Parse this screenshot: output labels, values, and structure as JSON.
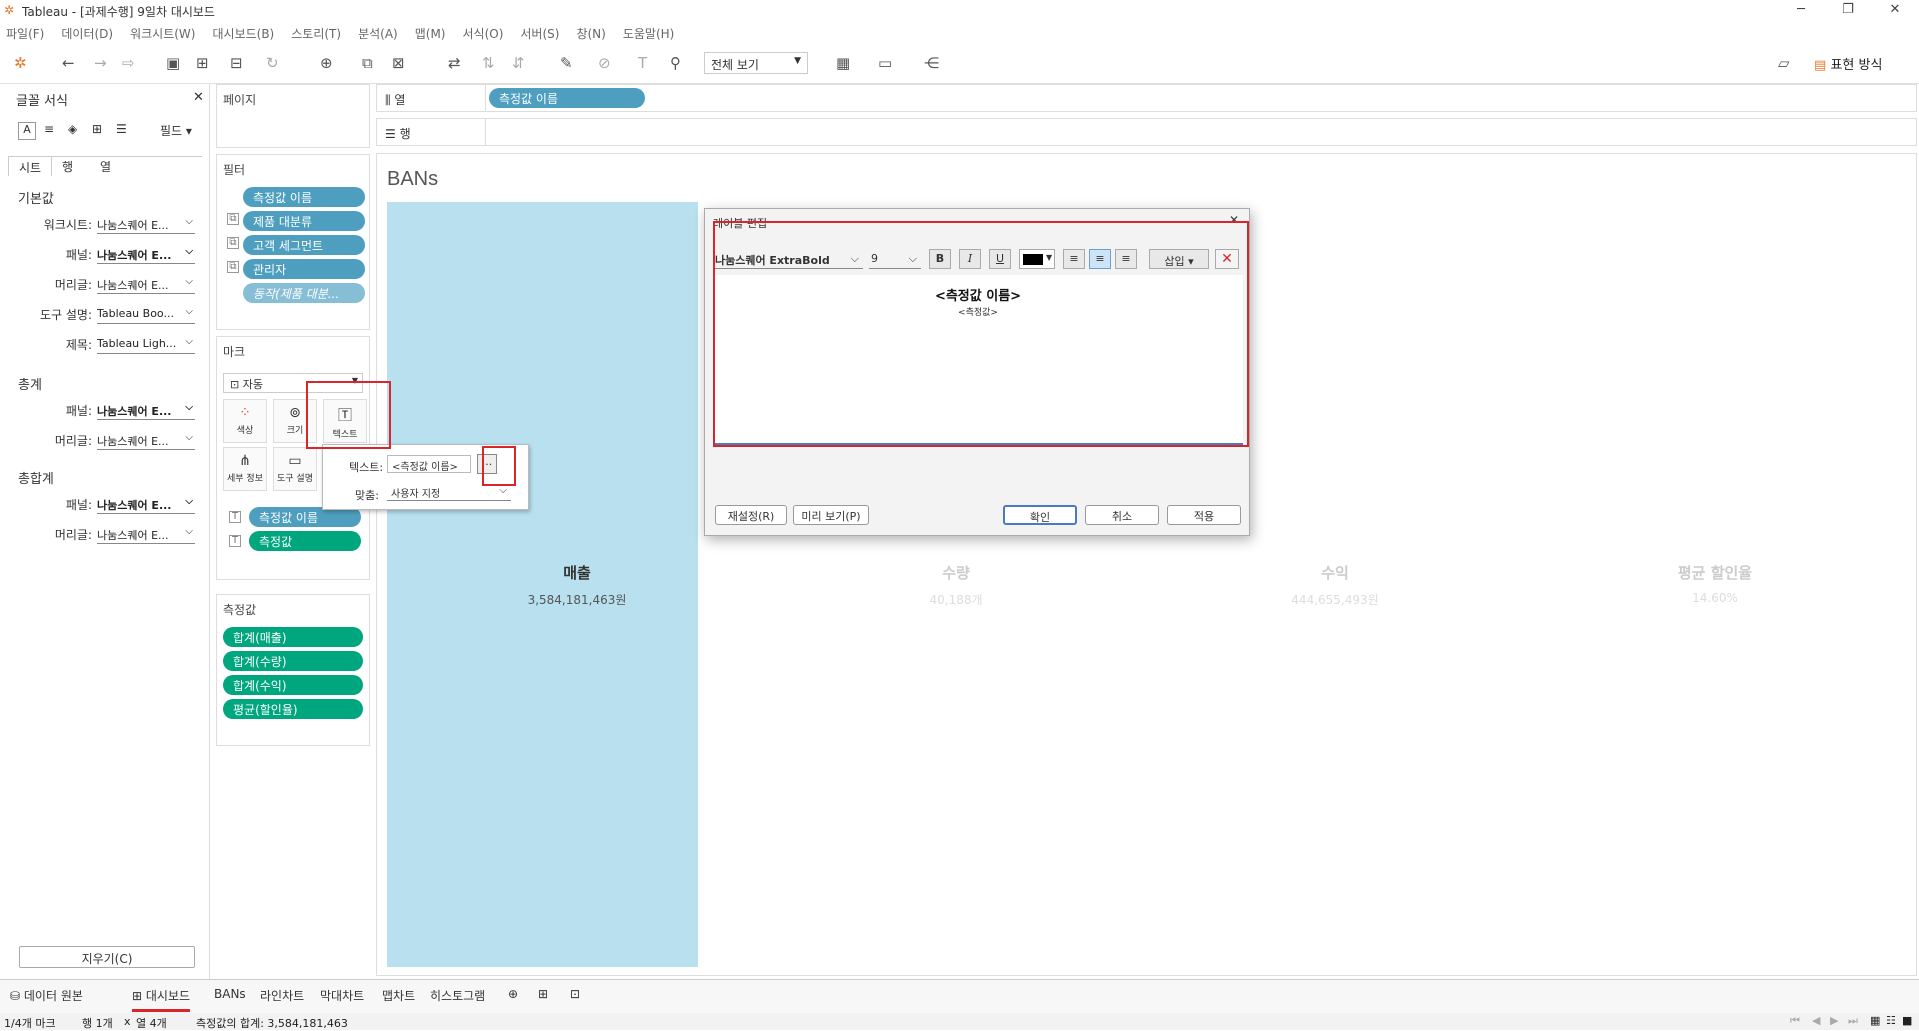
{
  "window": {
    "title": "Tableau - [과제수행] 9일차 대시보드"
  },
  "menu": [
    "파일(F)",
    "데이터(D)",
    "워크시트(W)",
    "대시보드(B)",
    "스토리(T)",
    "분석(A)",
    "맵(M)",
    "서식(O)",
    "서버(S)",
    "창(N)",
    "도움말(H)"
  ],
  "toolbar": {
    "view_select": "전체 보기",
    "show_me": "표현 방식"
  },
  "format_pane": {
    "title": "글꼴 서식",
    "field_btn": "필드",
    "tabs": [
      "시트",
      "행",
      "열"
    ],
    "section_default": "기본값",
    "section_total": "총계",
    "section_grand_total": "총합계",
    "rows": {
      "worksheet": {
        "label": "워크시트:",
        "value": "나눔스퀘어 E..."
      },
      "pane": {
        "label": "패널:",
        "value": "나눔스퀘어 E..."
      },
      "header": {
        "label": "머리글:",
        "value": "나눔스퀘어 E..."
      },
      "tooltip": {
        "label": "도구 설명:",
        "value": "Tableau Boo..."
      },
      "title": {
        "label": "제목:",
        "value": "Tableau Ligh..."
      },
      "total_pane": {
        "label": "패널:",
        "value": "나눔스퀘어 E..."
      },
      "total_header": {
        "label": "머리글:",
        "value": "나눔스퀘어 E..."
      },
      "gt_pane": {
        "label": "패널:",
        "value": "나눔스퀘어 E..."
      },
      "gt_header": {
        "label": "머리글:",
        "value": "나눔스퀘어 E..."
      }
    },
    "clear": "지우기(C)"
  },
  "pages_card": {
    "title": "페이지"
  },
  "filters_card": {
    "title": "필터",
    "items": [
      "측정값 이름",
      "제품 대분류",
      "고객 세그먼트",
      "관리자",
      "동작(제품 대분..."
    ]
  },
  "marks_card": {
    "title": "마크",
    "type": "자동",
    "buttons": {
      "color": "색상",
      "size": "크기",
      "text": "텍스트",
      "detail": "세부 정보",
      "tooltip": "도구 설명"
    },
    "pills": [
      "측정값 이름",
      "측정값"
    ]
  },
  "measures_card": {
    "title": "측정값",
    "items": [
      "합계(매출)",
      "합계(수량)",
      "합계(수익)",
      "평균(할인율)"
    ]
  },
  "shelves": {
    "columns_label": "열",
    "rows_label": "행",
    "columns_pill": "측정값 이름"
  },
  "sheet": {
    "title": "BANs"
  },
  "bans": [
    {
      "name": "매출",
      "value": "3,584,181,463원"
    },
    {
      "name": "수량",
      "value": "40,188개"
    },
    {
      "name": "수익",
      "value": "444,655,493원"
    },
    {
      "name": "평균 할인율",
      "value": "14.60%"
    }
  ],
  "text_popup": {
    "text_label": "텍스트:",
    "text_value": "<측정값 이름>",
    "more": "...",
    "align_label": "맞춤:",
    "align_value": "사용자 지정"
  },
  "label_dialog": {
    "title": "레이블 편집",
    "font": "나눔스퀘어 ExtraBold",
    "size": "9",
    "bold": "B",
    "italic": "I",
    "underline": "U",
    "insert": "삽입",
    "line1": "<측정값 이름>",
    "line2": "<측정값>",
    "reset": "재설정(R)",
    "preview": "미리 보기(P)",
    "ok": "확인",
    "cancel": "취소",
    "apply": "적용"
  },
  "tabs": {
    "data_source": "데이터 원본",
    "dashboard": "대시보드",
    "sheets": [
      "BANs",
      "라인차트",
      "막대차트",
      "맵차트",
      "히스토그램"
    ]
  },
  "status": {
    "marks": "1/4개 마크",
    "rows": "행 1개",
    "x": "x",
    "cols": "열 4개",
    "sum": "측정값의 합계: 3,584,181,463"
  },
  "colors": {
    "sales_bar": "#b8e0ee",
    "pill_blue": "#4e9fbf",
    "pill_green": "#00a67e",
    "highlight": "#d9262b"
  }
}
